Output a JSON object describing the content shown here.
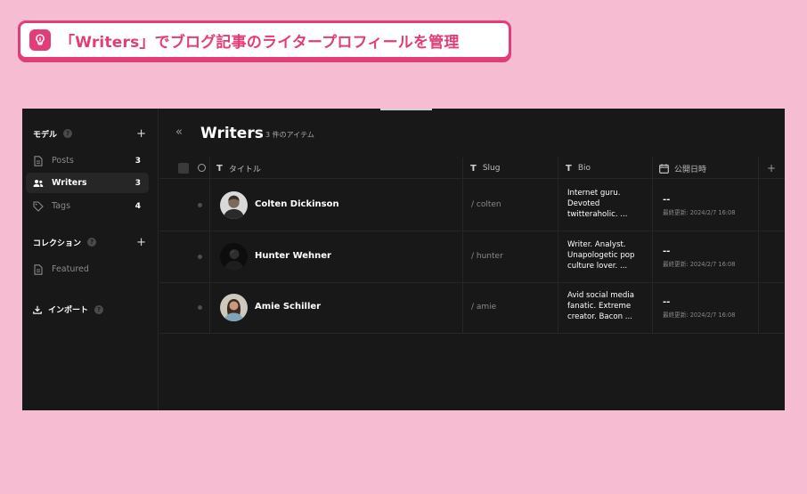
{
  "banner": {
    "title": "「Writers」でブログ記事のライタープロフィールを管理",
    "icon": "lightbulb-icon",
    "accent_color": "#e23d78",
    "background_color": "#f5bcd2"
  },
  "sidebar": {
    "models_label": "モデル",
    "models_help": "?",
    "models_add": "+",
    "models": [
      {
        "label": "Posts",
        "count": "3",
        "icon": "document-icon",
        "active": false
      },
      {
        "label": "Writers",
        "count": "3",
        "icon": "users-icon",
        "active": true
      },
      {
        "label": "Tags",
        "count": "4",
        "icon": "tag-icon",
        "active": false
      }
    ],
    "collections_label": "コレクション",
    "collections_help": "?",
    "collections_add": "+",
    "collections": [
      {
        "label": "Featured",
        "icon": "document-icon"
      }
    ],
    "import_label": "インポート",
    "import_help": "?"
  },
  "main": {
    "collapse_glyph": "«",
    "title": "Writers",
    "item_count": "3 件のアイテム",
    "columns": {
      "title": "タイトル",
      "slug": "Slug",
      "bio": "Bio",
      "published": "公開日時",
      "text_type_glyph": "T",
      "add": "+"
    },
    "rows": [
      {
        "name": "Colten Dickinson",
        "slug": "/ colten",
        "bio": [
          "Internet guru.",
          "Devoted",
          "twitteraholic. ..."
        ],
        "published": "--",
        "updated": "最終更新: 2024/2/7 16:08"
      },
      {
        "name": "Hunter Wehner",
        "slug": "/ hunter",
        "bio": [
          "Writer. Analyst.",
          "Unapologetic pop",
          "culture lover. ..."
        ],
        "published": "--",
        "updated": "最終更新: 2024/2/7 16:08"
      },
      {
        "name": "Amie Schiller",
        "slug": "/ amie",
        "bio": [
          "Avid social media",
          "fanatic. Extreme",
          "creator. Bacon ..."
        ],
        "published": "--",
        "updated": "最終更新: 2024/2/7 16:08"
      }
    ]
  }
}
